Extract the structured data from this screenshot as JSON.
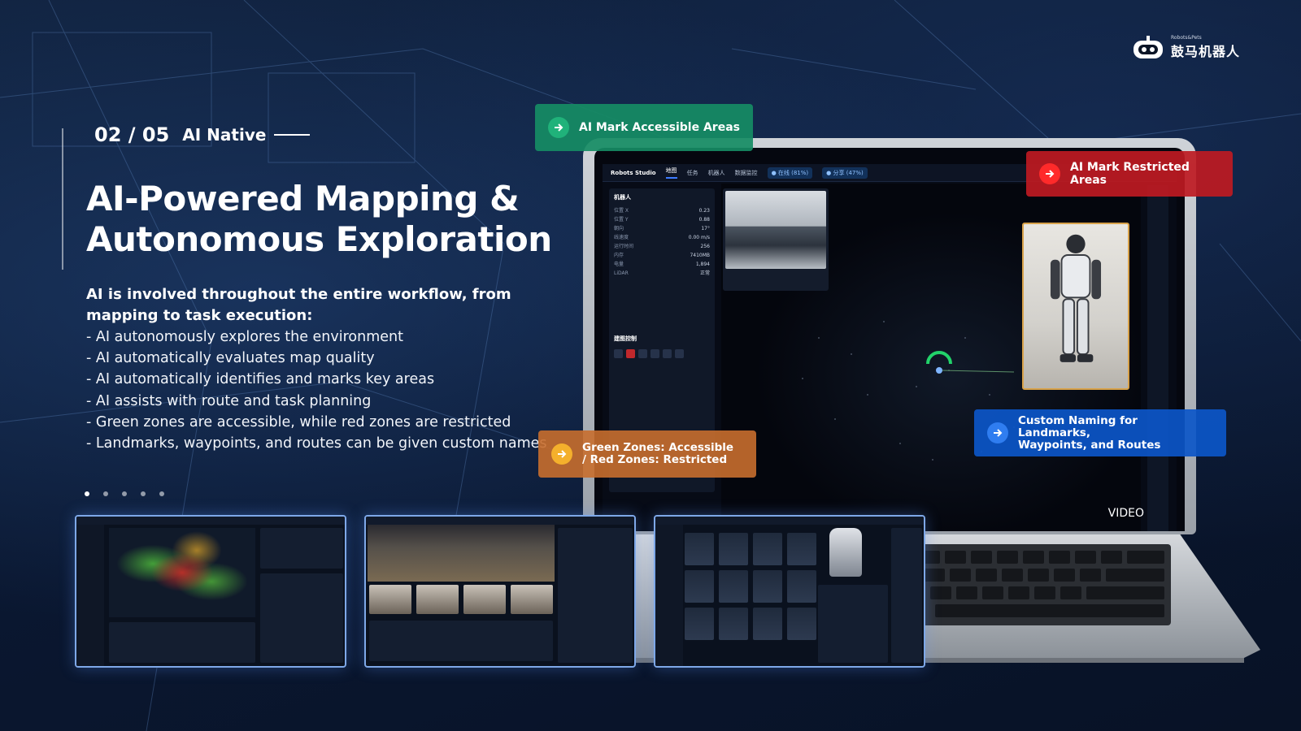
{
  "logo": {
    "small": "Robots&Pets",
    "main": "鼓马机器人"
  },
  "pager": {
    "current": "02 / 05",
    "section": "AI Native"
  },
  "title": {
    "line1": "AI-Powered Mapping &",
    "line2": "Autonomous Exploration"
  },
  "intro": "AI is involved throughout the entire workflow, from mapping to task execution:",
  "bullets": [
    "- AI autonomously explores the environment",
    "- AI automatically evaluates map quality",
    "- AI automatically identifies and marks key areas",
    "- AI assists with route and task planning",
    "- Green zones are accessible, while red zones are restricted",
    "- Landmarks, waypoints, and routes can be given custom names"
  ],
  "dots": {
    "count": 5,
    "active": 0
  },
  "callouts": {
    "green": "AI Mark Accessible Areas",
    "red": "AI Mark Restricted Areas",
    "blue_line1": "Custom Naming for Landmarks,",
    "blue_line2": "Waypoints, and Routes",
    "orange_line1": "Green Zones: Accessible",
    "orange_line2": "/ Red Zones: Restricted"
  },
  "screen": {
    "brand": "Robots Studio",
    "tabs": [
      "地图",
      "任务",
      "机器人",
      "数据监控"
    ],
    "chips": [
      "● 在线 (81%)",
      "● 分享 (47%)"
    ],
    "panel_title": "机器人",
    "panel_rows": [
      {
        "k": "位置 X",
        "v": "0.23"
      },
      {
        "k": "位置 Y",
        "v": "0.88"
      },
      {
        "k": "朝向",
        "v": "17°"
      },
      {
        "k": "线速度",
        "v": "0.00 m/s"
      },
      {
        "k": "运行时间",
        "v": "256"
      },
      {
        "k": "内存",
        "v": "7410MB"
      },
      {
        "k": "电量",
        "v": "1,894"
      },
      {
        "k": "LiDAR",
        "v": "正常"
      }
    ],
    "control_title": "建图控制",
    "video_label": "VIDEO"
  },
  "colors": {
    "green": "#168c64",
    "red": "#be1a22",
    "blue": "#0c56c8",
    "orange": "#c86e2e"
  }
}
